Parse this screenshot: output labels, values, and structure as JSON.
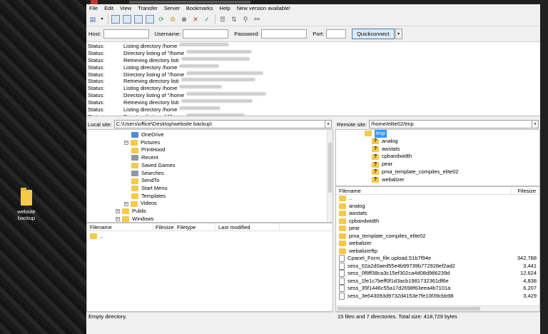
{
  "desktop": {
    "icon_label": "website backup"
  },
  "menu": [
    "File",
    "Edit",
    "View",
    "Transfer",
    "Server",
    "Bookmarks",
    "Help",
    "New version available!"
  ],
  "quickconnect": {
    "host_label": "Host:",
    "user_label": "Username:",
    "pass_label": "Password:",
    "port_label": "Port:",
    "button": "Quickconnect"
  },
  "log": [
    {
      "k": "Status:",
      "v": "Listing directory /home"
    },
    {
      "k": "Status:",
      "v": "Directory listing of \"/home"
    },
    {
      "k": "Status:",
      "v": "Retrieving directory listi"
    },
    {
      "k": "Status:",
      "v": "Listing directory /home"
    },
    {
      "k": "Status:",
      "v": "Directory listing of \"/home"
    },
    {
      "k": "Status:",
      "v": "Retrieving directory listi"
    },
    {
      "k": "Status:",
      "v": "Listing directory /home"
    },
    {
      "k": "Status:",
      "v": "Directory listing of \"/home"
    },
    {
      "k": "Status:",
      "v": "Retrieving directory listi"
    },
    {
      "k": "Status:",
      "v": "Listing directory /home"
    },
    {
      "k": "Status:",
      "v": "Directory listing of \"/home"
    }
  ],
  "local": {
    "label": "Local site:",
    "path": "C:\\Users\\office\\Desktop\\website backup\\",
    "tree": [
      "OneDrive",
      "Pictures",
      "PrintHood",
      "Recent",
      "Saved Games",
      "Searches",
      "SendTo",
      "Start Menu",
      "Templates",
      "Videos",
      "Public",
      "Windows"
    ],
    "columns": [
      "Filename",
      "Filesize",
      "Filetype",
      "Last modified"
    ],
    "files": [
      ".."
    ],
    "status": "Empty directory."
  },
  "remote": {
    "label": "Remote site:",
    "path": "/home/elite02/tmp",
    "tree": [
      "tmp",
      "analog",
      "awstats",
      "cpbandwidth",
      "pear",
      "pma_template_compiles_elite02",
      "webalizer"
    ],
    "columns": [
      "Filename",
      "Filesize"
    ],
    "files": [
      {
        "name": "..",
        "size": ""
      },
      {
        "name": "analog",
        "size": ""
      },
      {
        "name": "awstats",
        "size": ""
      },
      {
        "name": "cpbandwidth",
        "size": ""
      },
      {
        "name": "pear",
        "size": ""
      },
      {
        "name": "pma_template_compiles_elite02",
        "size": ""
      },
      {
        "name": "webalizer",
        "size": ""
      },
      {
        "name": "webalizerftp",
        "size": ""
      },
      {
        "name": "Cpanel_Form_file.upload.51b7f94e",
        "size": "342,788"
      },
      {
        "name": "sess_02a2d0aed55e4b99739b772928ef2ad2",
        "size": "3,441"
      },
      {
        "name": "sess_0f8ff38ca3c15ef302ca4d08d986239d",
        "size": "12,624"
      },
      {
        "name": "sess_1fe1c7beff0f1d3acb1981732361df6e",
        "size": "4,838"
      },
      {
        "name": "sess_35f1446c55a17d2698f63eea4b7101a",
        "size": "6,207"
      },
      {
        "name": "sess_3e643093d9732d4153e7fe10f39cbb98",
        "size": "3,429"
      }
    ],
    "status": "15 files and 7 directories. Total size: 418,729 bytes"
  }
}
